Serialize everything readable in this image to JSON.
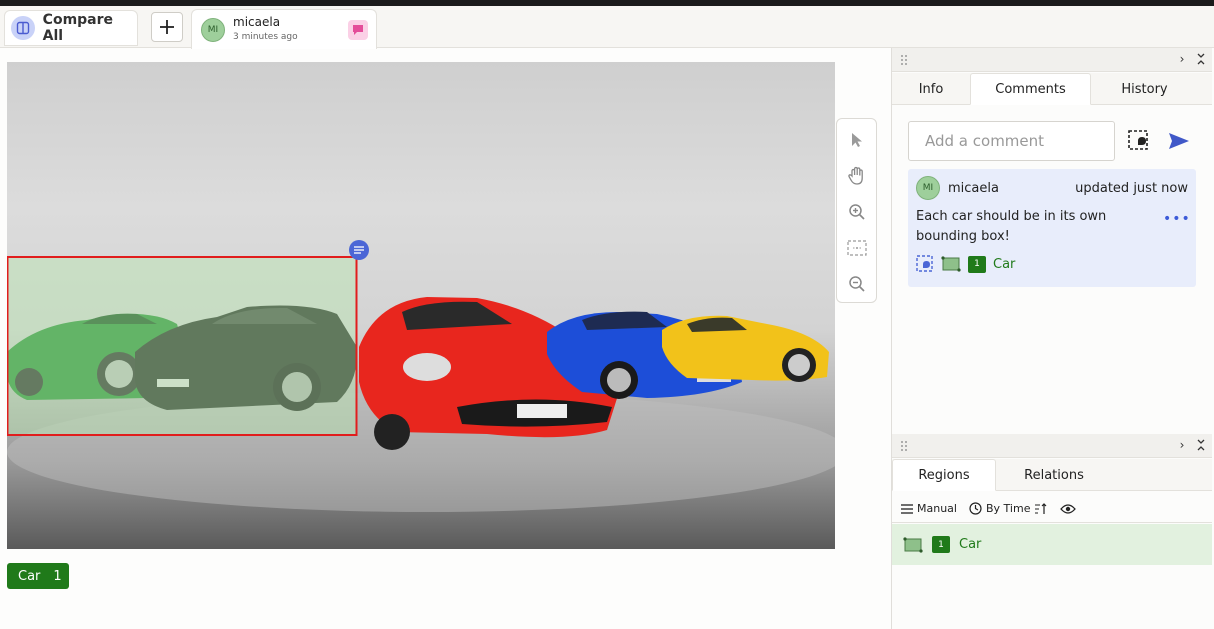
{
  "tabbar": {
    "compare_label": "Compare All",
    "annotation": {
      "avatar_initials": "MI",
      "user": "micaela",
      "time": "3 minutes ago"
    }
  },
  "toolbar": {
    "tools": [
      "pointer-icon",
      "hand-icon",
      "zoom-in-icon",
      "fit-icon",
      "zoom-out-icon"
    ]
  },
  "canvas": {
    "bbox_label": "Car",
    "bbox_count": "1"
  },
  "side_panel": {
    "tabs": [
      "Info",
      "Comments",
      "History"
    ],
    "active_tab": "Comments",
    "comment_placeholder": "Add a comment",
    "comment": {
      "avatar_initials": "MI",
      "user": "micaela",
      "time": "updated just now",
      "text": "Each car should be in its own bounding box!",
      "region_index": "1",
      "region_label": "Car"
    }
  },
  "regions_panel": {
    "tabs": [
      "Regions",
      "Relations"
    ],
    "active_tab": "Regions",
    "sort_manual": "Manual",
    "sort_by_time": "By Time",
    "regions": [
      {
        "index": "1",
        "label": "Car"
      }
    ]
  },
  "colors": {
    "accent": "#207a1a",
    "comment_bg": "#e8edfb",
    "link_blue": "#3d5bd8",
    "bbox_red": "#e11d1d"
  }
}
